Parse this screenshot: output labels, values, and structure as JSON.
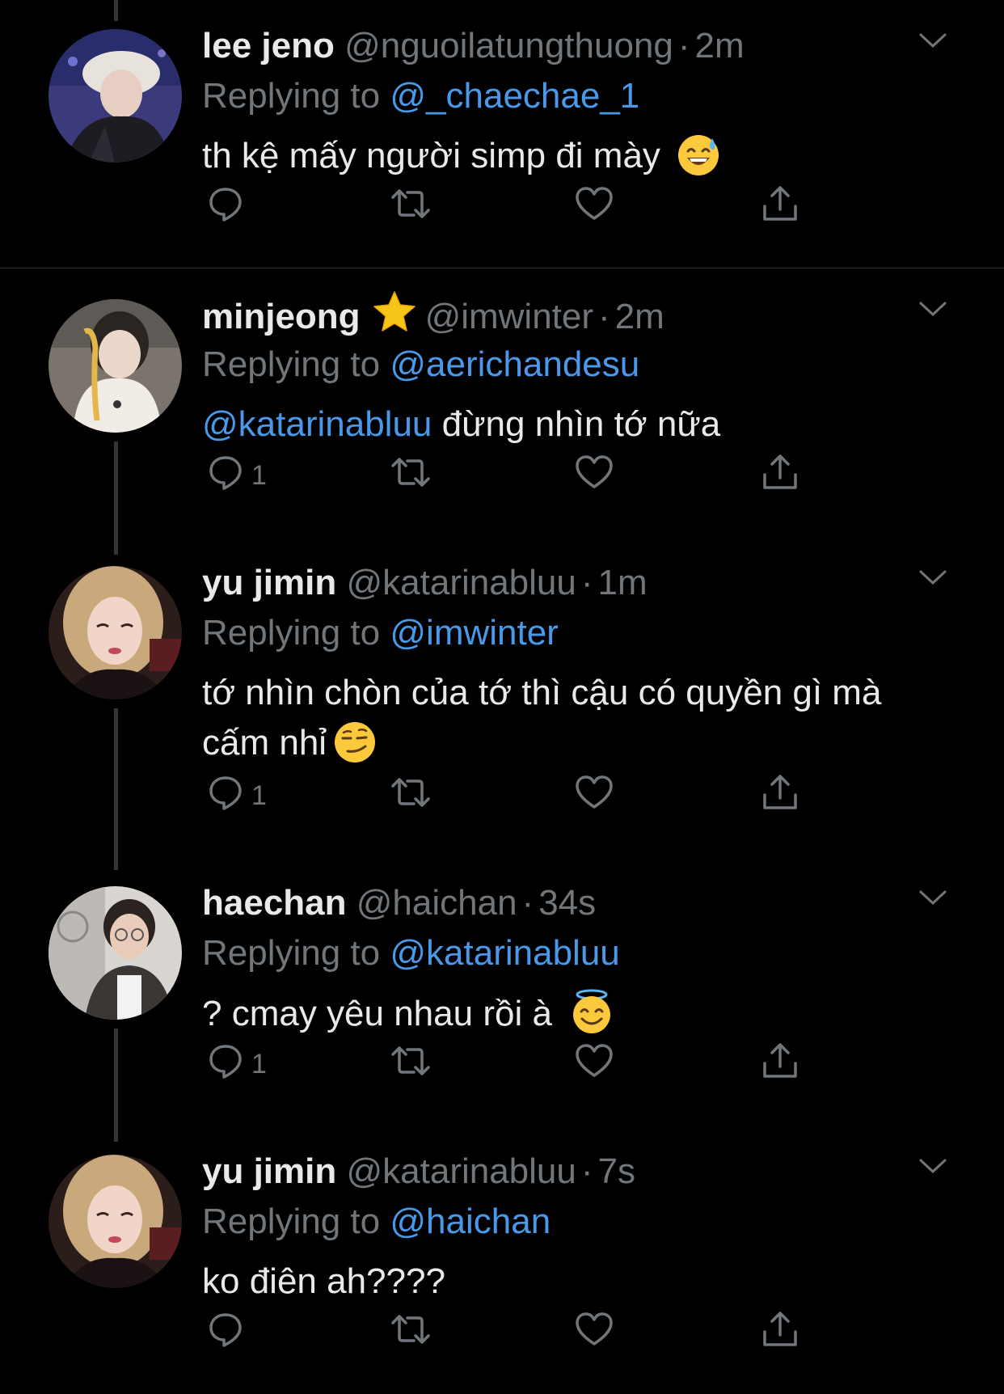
{
  "tweets": [
    {
      "name": "lee jeno",
      "handle": "@nguoilatungthuong",
      "time": "2m",
      "replying_prefix": "Replying to",
      "replying_to": "@_chaechae_1",
      "text_mention": "",
      "text": "th kệ mấy người simp đi mày",
      "text2": "",
      "emoji": "sweat-smile",
      "reply_count": ""
    },
    {
      "name": "minjeong",
      "handle": "@imwinter",
      "time": "2m",
      "replying_prefix": "Replying to",
      "replying_to": "@aerichandesu",
      "text_mention": "@katarinabluu",
      "text": " đừng nhìn tớ nữa",
      "text2": "",
      "emoji": "",
      "reply_count": "1"
    },
    {
      "name": "yu jimin",
      "handle": "@katarinabluu",
      "time": "1m",
      "replying_prefix": "Replying to",
      "replying_to": "@imwinter",
      "text_mention": "",
      "text": "tớ nhìn chòn của tớ thì cậu có quyền gì mà",
      "text2": "cấm nhỉ",
      "emoji": "smirk",
      "reply_count": "1"
    },
    {
      "name": "haechan",
      "handle": "@haichan",
      "time": "34s",
      "replying_prefix": "Replying to",
      "replying_to": "@katarinabluu",
      "text_mention": "",
      "text": "? cmay yêu nhau rồi à",
      "text2": "",
      "emoji": "halo",
      "reply_count": "1"
    },
    {
      "name": "yu jimin",
      "handle": "@katarinabluu",
      "time": "7s",
      "replying_prefix": "Replying to",
      "replying_to": "@haichan",
      "text_mention": "",
      "text": "ko điên ah????",
      "text2": "",
      "emoji": "",
      "reply_count": ""
    }
  ],
  "separator": "·",
  "colors": {
    "background": "#000000",
    "text": "#e7e9ea",
    "secondary": "#71767b",
    "mention": "#4a99e9",
    "star": "#f5c518"
  },
  "icons": [
    "reply-icon",
    "retweet-icon",
    "like-icon",
    "share-icon",
    "chevron-down-icon",
    "star-badge-icon"
  ]
}
